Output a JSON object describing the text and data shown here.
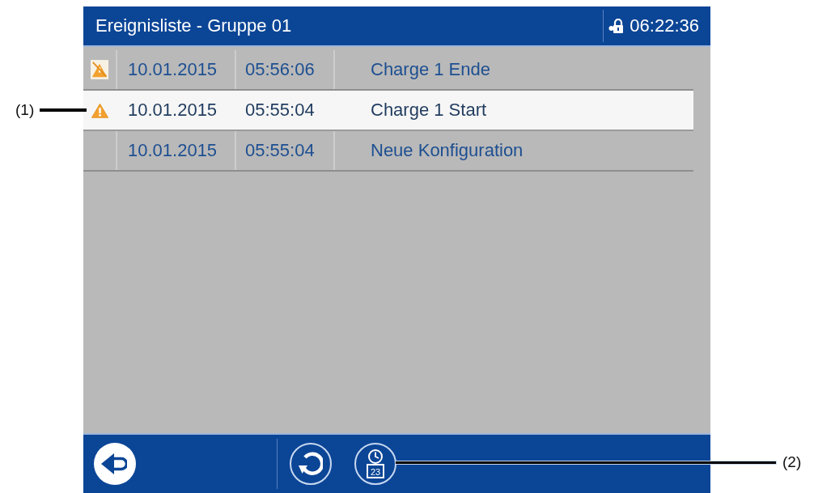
{
  "header": {
    "title": "Ereignisliste - Gruppe 01",
    "time": "06:22:36"
  },
  "rows": [
    {
      "kind": "alarm_cleared",
      "date": "10.01.2015",
      "time": "05:56:06",
      "event": "Charge 1 Ende",
      "selected": false
    },
    {
      "kind": "alarm",
      "date": "10.01.2015",
      "time": "05:55:04",
      "event": "Charge 1 Start",
      "selected": true
    },
    {
      "kind": "message",
      "date": "10.01.2015",
      "time": "05:55:04",
      "event": "Neue Konfiguration",
      "selected": false
    }
  ],
  "footer": {
    "buttons": [
      {
        "kind": "back"
      },
      {
        "kind": "refresh"
      },
      {
        "kind": "calendar",
        "day": "23"
      }
    ]
  },
  "callouts": [
    {
      "label": "(1)"
    },
    {
      "label": "(2)"
    }
  ]
}
